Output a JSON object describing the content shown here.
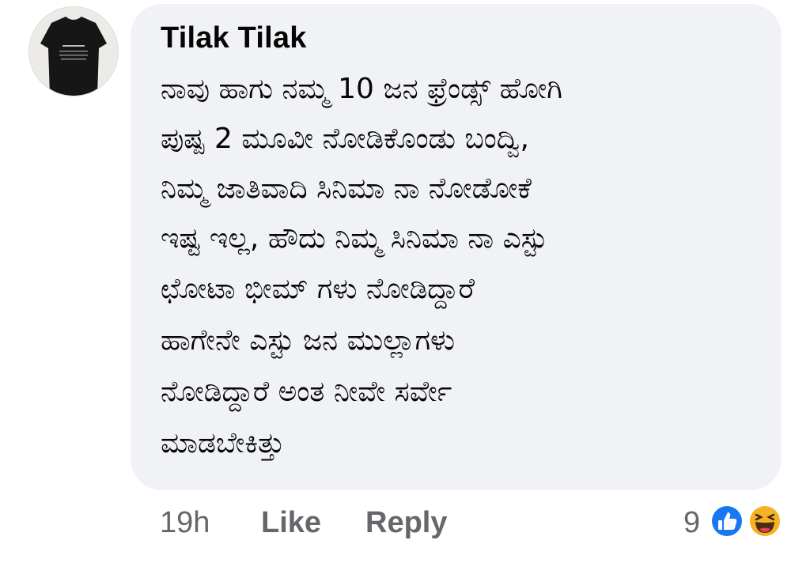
{
  "comment": {
    "author": "Tilak Tilak",
    "lines": [
      "ನಾವು ಹಾಗು ನಮ್ಮ 10 ಜನ ಫ್ರೆಂಡ್ಸ್ ಹೋಗಿ",
      "ಪುಷ್ಪ 2 ಮೂವೀ ನೋಡಿಕೊಂಡು ಬಂದ್ವಿ,",
      "ನಿಮ್ಮ ಜಾತಿವಾದಿ ಸಿನಿಮಾ ನಾ ನೋಡೋಕೆ",
      "ಇಷ್ಟ ಇಲ್ಲ, ಹೌದು ನಿಮ್ಮ ಸಿನಿಮಾ ನಾ ಎಸ್ಟು",
      "ಛೋಟಾ ಭೀಮ್ ಗಳು ನೋಡಿದ್ದಾರೆ",
      "ಹಾಗೇನೇ ಎಸ್ಟು ಜನ ಮುಲ್ಲಾಗಳು",
      "ನೋಡಿದ್ದಾರೆ ಅಂತ ನೀವೇ ಸರ್ವೇ",
      "ಮಾಡಬೇಕಿತ್ತು"
    ],
    "timestamp": "19h",
    "like_label": "Like",
    "reply_label": "Reply",
    "reaction_count": "9",
    "reaction_icons": [
      "like-icon",
      "haha-icon"
    ]
  },
  "colors": {
    "bubble": "#f0f2f5",
    "text": "#050505",
    "meta": "#65676b",
    "like_blue": "#1877f2",
    "haha_yellow": "#f7b125"
  }
}
